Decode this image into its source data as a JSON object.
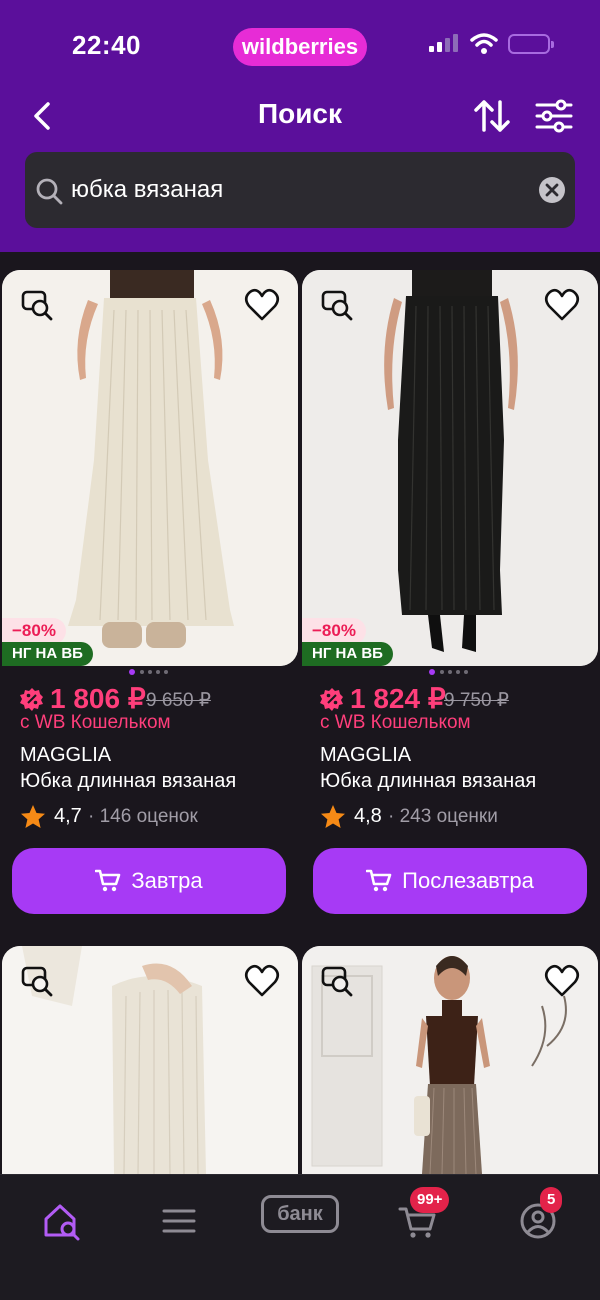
{
  "status_bar": {
    "time": "22:40",
    "brand": "wildberries",
    "icons": [
      "signal-icon",
      "wifi-icon",
      "battery-icon"
    ]
  },
  "header": {
    "title": "Поиск",
    "back_icon": "chevron-left-icon",
    "sort_icon": "sort-icon",
    "filter_icon": "filter-icon"
  },
  "search": {
    "value": "юбка вязаная",
    "icon": "search-icon",
    "clear_icon": "clear-icon"
  },
  "products": [
    {
      "discount": "−80%",
      "badge": "НГ НА ВБ",
      "price": "1 806 ₽",
      "old_price": "9 650 ₽",
      "wallet": "с WB Кошельком",
      "brand": "MAGGLIA",
      "title": "Юбка длинная вязаная",
      "rating": "4,7",
      "reviews": "· 146 оценок",
      "button": "Завтра",
      "skirt_color": "#e8e1d0"
    },
    {
      "discount": "−80%",
      "badge": "НГ НА ВБ",
      "price": "1 824 ₽",
      "old_price": "9 750 ₽",
      "wallet": "с WB Кошельком",
      "brand": "MAGGLIA",
      "title": "Юбка длинная вязаная",
      "rating": "4,8",
      "reviews": "· 243 оценки",
      "button": "Послезавтра",
      "skirt_color": "#1a1a19"
    }
  ],
  "tabbar": {
    "items": [
      "home-search-icon",
      "catalog-icon",
      "bank-icon",
      "cart-icon",
      "profile-icon"
    ],
    "bank_label": "банк",
    "cart_badge": "99+",
    "profile_badge": "5"
  },
  "colors": {
    "header": "#5b0f9b",
    "accent": "#a73af5",
    "price": "#ff3e7b",
    "brand_pill": "#e72cd6"
  }
}
